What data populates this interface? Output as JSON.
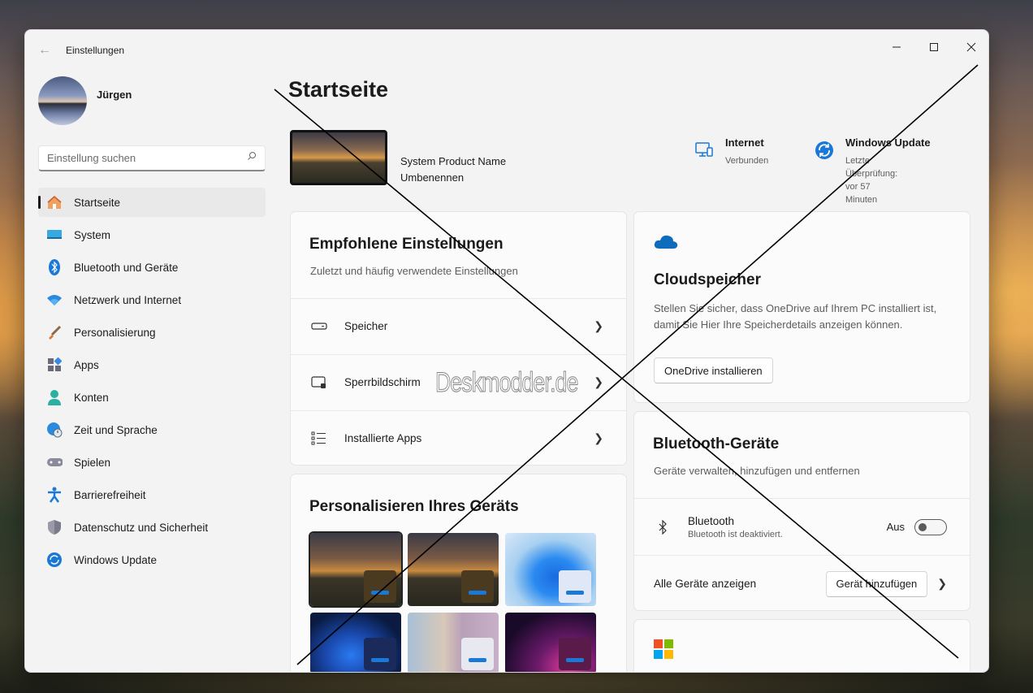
{
  "window": {
    "title": "Einstellungen",
    "minimize": "─",
    "maximize": "☐",
    "close": "✕"
  },
  "user": {
    "name": "Jürgen"
  },
  "search": {
    "placeholder": "Einstellung suchen"
  },
  "sidebar": {
    "items": [
      {
        "label": "Startseite",
        "icon": "home-icon",
        "active": true
      },
      {
        "label": "System",
        "icon": "system-display-icon"
      },
      {
        "label": "Bluetooth und Geräte",
        "icon": "bluetooth-icon"
      },
      {
        "label": "Netzwerk und Internet",
        "icon": "wifi-icon"
      },
      {
        "label": "Personalisierung",
        "icon": "brush-icon"
      },
      {
        "label": "Apps",
        "icon": "apps-icon"
      },
      {
        "label": "Konten",
        "icon": "person-icon"
      },
      {
        "label": "Zeit und Sprache",
        "icon": "globe-clock-icon"
      },
      {
        "label": "Spielen",
        "icon": "gamepad-icon"
      },
      {
        "label": "Barrierefreiheit",
        "icon": "accessibility-icon"
      },
      {
        "label": "Datenschutz und Sicherheit",
        "icon": "shield-icon"
      },
      {
        "label": "Windows Update",
        "icon": "update-icon"
      }
    ]
  },
  "main": {
    "title": "Startseite",
    "device": {
      "name": "System Product Name",
      "rename": "Umbenennen"
    },
    "internet": {
      "title": "Internet",
      "status": "Verbunden"
    },
    "windows_update": {
      "title": "Windows Update",
      "status_line1": "Letzte Überprüfung: vor 57",
      "status_line2": "Minuten"
    },
    "recommended": {
      "title": "Empfohlene Einstellungen",
      "subtitle": "Zuletzt und häufig verwendete Einstellungen",
      "rows": [
        {
          "label": "Speicher",
          "icon": "storage-drive-icon"
        },
        {
          "label": "Sperrbildschirm",
          "icon": "lock-screen-icon"
        },
        {
          "label": "Installierte Apps",
          "icon": "app-list-icon"
        }
      ]
    },
    "personalize": {
      "title": "Personalisieren Ihres Geräts"
    },
    "cloud": {
      "title": "Cloudspeicher",
      "desc1": "Stellen Sie sicher, dass OneDrive auf Ihrem PC installiert ist,",
      "desc2": "damit Sie Hier Ihre Speicherdetails anzeigen können.",
      "button": "OneDrive installieren"
    },
    "bluetooth": {
      "title": "Bluetooth-Geräte",
      "subtitle": "Geräte verwalten, hinzufügen und entfernen",
      "device_label": "Bluetooth",
      "device_status": "Bluetooth ist deaktiviert.",
      "toggle_label": "Aus",
      "toggle_on": false,
      "all_devices": "Alle Geräte anzeigen",
      "add_button": "Gerät hinzufügen"
    }
  },
  "watermark": "Deskmodder.de",
  "colors": {
    "accent": "#0067c0",
    "onedrive": "#0f6cbd",
    "background": "#f3f3f3"
  }
}
